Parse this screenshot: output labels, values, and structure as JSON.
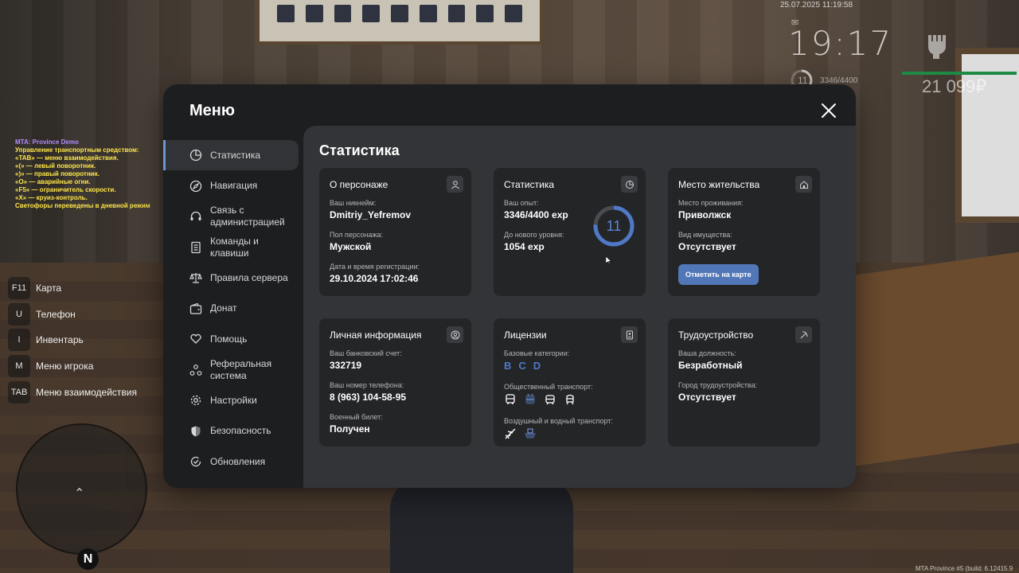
{
  "hud": {
    "datetime": "25.07.2025 11:19:58",
    "time": "19:17",
    "level": "11",
    "exp": "3346/4400",
    "money": "21 099₽",
    "health_color": "#1e8a44"
  },
  "chat": [
    {
      "text": "MTA: Province Demo",
      "color": "purple"
    },
    {
      "text": "Управление транспортным средством:",
      "color": "yellow"
    },
    {
      "text": "«TAB» — меню взаимодействия.",
      "color": "white"
    },
    {
      "text": "«(» — левый поворотник.",
      "color": "white"
    },
    {
      "text": "«)» — правый поворотник.",
      "color": "white"
    },
    {
      "text": "«O» — аварийные огни.",
      "color": "white"
    },
    {
      "text": "«F5» — ограничитель скорости.",
      "color": "white"
    },
    {
      "text": "«X» — круиз-контроль.",
      "color": "white"
    },
    {
      "text": "Светофоры переведены в дневной режим",
      "color": "yellow"
    }
  ],
  "keys": [
    {
      "key": "F11",
      "label": "Карта"
    },
    {
      "key": "U",
      "label": "Телефон"
    },
    {
      "key": "I",
      "label": "Инвентарь"
    },
    {
      "key": "M",
      "label": "Меню игрока"
    },
    {
      "key": "TAB",
      "label": "Меню взаимодействия"
    }
  ],
  "minimap": {
    "north": "N"
  },
  "build": "MTA Province #5 (build: 6.12415.9",
  "menu": {
    "title": "Меню",
    "accent": "#6b93d6",
    "nav": [
      {
        "label": "Статистика",
        "icon": "pie-chart-icon",
        "active": true
      },
      {
        "label": "Навигация",
        "icon": "compass-icon"
      },
      {
        "label": "Связь с администрацией",
        "icon": "headset-icon"
      },
      {
        "label": "Команды и клавиши",
        "icon": "document-icon"
      },
      {
        "label": "Правила сервера",
        "icon": "scales-icon"
      },
      {
        "label": "Донат",
        "icon": "wallet-icon"
      },
      {
        "label": "Помощь",
        "icon": "heart-hand-icon"
      },
      {
        "label": "Реферальная система",
        "icon": "referral-icon"
      },
      {
        "label": "Настройки",
        "icon": "gear-icon"
      },
      {
        "label": "Безопасность",
        "icon": "shield-icon"
      },
      {
        "label": "Обновления",
        "icon": "refresh-check-icon"
      }
    ],
    "section_title": "Статистика",
    "cards": {
      "character": {
        "title": "О персонаже",
        "nickname_label": "Ваш никнейм:",
        "nickname": "Dmitriy_Yefremov",
        "gender_label": "Пол персонажа:",
        "gender": "Мужской",
        "reg_label": "Дата и время регистрации:",
        "reg": "29.10.2024 17:02:46"
      },
      "stats": {
        "title": "Статистика",
        "exp_label": "Ваш опыт:",
        "exp": "3346/4400 exp",
        "next_label": "До нового уровня:",
        "next": "1054 exp",
        "level": "11",
        "progress": 0.76
      },
      "residence": {
        "title": "Место жительства",
        "place_label": "Место проживания:",
        "place": "Приволжск",
        "property_label": "Вид имущества:",
        "property": "Отсутствует",
        "button": "Отметить на карте"
      },
      "personal": {
        "title": "Личная информация",
        "bank_label": "Ваш банковский счет:",
        "bank": "332719",
        "phone_label": "Ваш номер телефона:",
        "phone": "8 (963) 104-58-95",
        "military_label": "Военный билет:",
        "military": "Получен"
      },
      "licenses": {
        "title": "Лицензии",
        "base_label": "Базовые категории:",
        "base": [
          "B",
          "C",
          "D"
        ],
        "public_label": "Общественный транспорт:",
        "public_icons": [
          "bus-icon",
          "trolleybus-icon",
          "tram-icon",
          "train-icon"
        ],
        "air_label": "Воздушный и водный транспорт:",
        "air_icons": [
          "plane-icon",
          "boat-icon"
        ]
      },
      "job": {
        "title": "Трудоустройство",
        "position_label": "Ваша должность:",
        "position": "Безработный",
        "city_label": "Город трудоустройства:",
        "city": "Отсутствует"
      }
    }
  }
}
